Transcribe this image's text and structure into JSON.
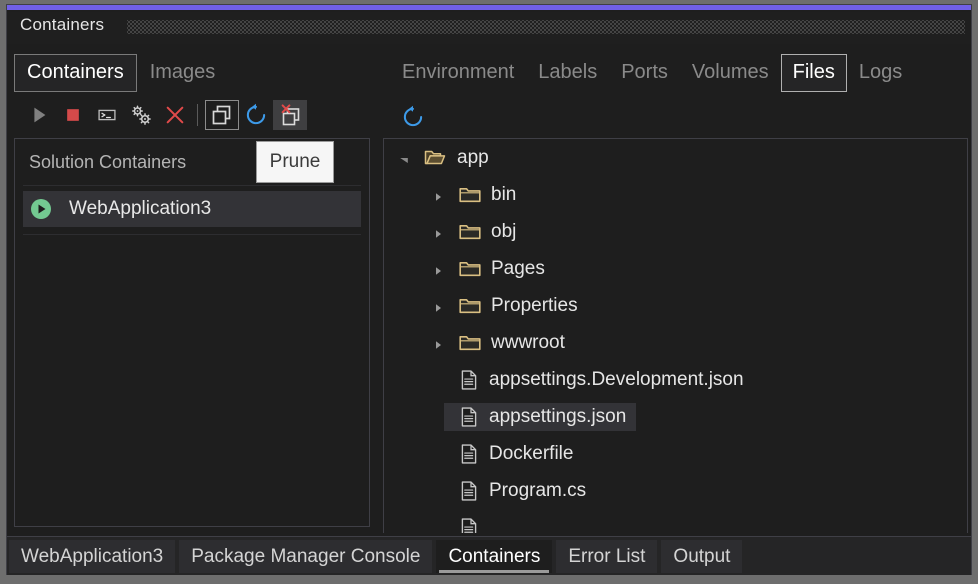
{
  "window": {
    "title": "Containers",
    "accent_color": "#7160e8"
  },
  "left_pane": {
    "subtabs": [
      {
        "label": "Containers",
        "active": true
      },
      {
        "label": "Images",
        "active": false
      }
    ],
    "toolbar": [
      {
        "name": "start-button",
        "icon": "play-icon",
        "state": "normal"
      },
      {
        "name": "stop-button",
        "icon": "stop-square-icon",
        "state": "normal"
      },
      {
        "name": "terminal-button",
        "icon": "terminal-icon",
        "state": "normal"
      },
      {
        "name": "settings-button",
        "icon": "gears-icon",
        "state": "normal"
      },
      {
        "name": "remove-button",
        "icon": "close-x-icon",
        "state": "normal"
      },
      {
        "name": "show-all-containers-button",
        "icon": "stacked-windows-icon",
        "state": "bordered"
      },
      {
        "name": "refresh-button",
        "icon": "refresh-icon",
        "state": "normal"
      },
      {
        "name": "prune-button",
        "icon": "prune-icon",
        "state": "hovered"
      }
    ],
    "list_header": "Solution Containers",
    "containers": [
      {
        "name": "WebApplication3",
        "status_icon": "running-play-icon",
        "selected": true
      }
    ]
  },
  "tooltip": {
    "text": "Prune",
    "for": "prune-button"
  },
  "right_pane": {
    "tabs": [
      {
        "label": "Environment",
        "active": false
      },
      {
        "label": "Labels",
        "active": false
      },
      {
        "label": "Ports",
        "active": false
      },
      {
        "label": "Volumes",
        "active": false
      },
      {
        "label": "Files",
        "active": true
      },
      {
        "label": "Logs",
        "active": false
      }
    ],
    "toolbar": [
      {
        "name": "refresh-files-button",
        "icon": "refresh-icon"
      }
    ],
    "tree": [
      {
        "label": "app",
        "type": "folder-open",
        "depth": 0,
        "expanded": true,
        "twisty": "down",
        "selected": false
      },
      {
        "label": "bin",
        "type": "folder",
        "depth": 1,
        "expanded": false,
        "twisty": "right",
        "selected": false
      },
      {
        "label": "obj",
        "type": "folder",
        "depth": 1,
        "expanded": false,
        "twisty": "right",
        "selected": false
      },
      {
        "label": "Pages",
        "type": "folder",
        "depth": 1,
        "expanded": false,
        "twisty": "right",
        "selected": false
      },
      {
        "label": "Properties",
        "type": "folder",
        "depth": 1,
        "expanded": false,
        "twisty": "right",
        "selected": false
      },
      {
        "label": "wwwroot",
        "type": "folder",
        "depth": 1,
        "expanded": false,
        "twisty": "right",
        "selected": false
      },
      {
        "label": "appsettings.Development.json",
        "type": "file",
        "depth": 1,
        "expanded": false,
        "twisty": "none",
        "selected": false
      },
      {
        "label": "appsettings.json",
        "type": "file",
        "depth": 1,
        "expanded": false,
        "twisty": "none",
        "selected": true
      },
      {
        "label": "Dockerfile",
        "type": "file",
        "depth": 1,
        "expanded": false,
        "twisty": "none",
        "selected": false
      },
      {
        "label": "Program.cs",
        "type": "file",
        "depth": 1,
        "expanded": false,
        "twisty": "none",
        "selected": false
      },
      {
        "label": "",
        "type": "file",
        "depth": 1,
        "expanded": false,
        "twisty": "none",
        "selected": false
      }
    ]
  },
  "bottom_tabs": [
    {
      "label": "WebApplication3",
      "active": false
    },
    {
      "label": "Package Manager Console",
      "active": false
    },
    {
      "label": "Containers",
      "active": true
    },
    {
      "label": "Error List",
      "active": false
    },
    {
      "label": "Output",
      "active": false
    }
  ]
}
